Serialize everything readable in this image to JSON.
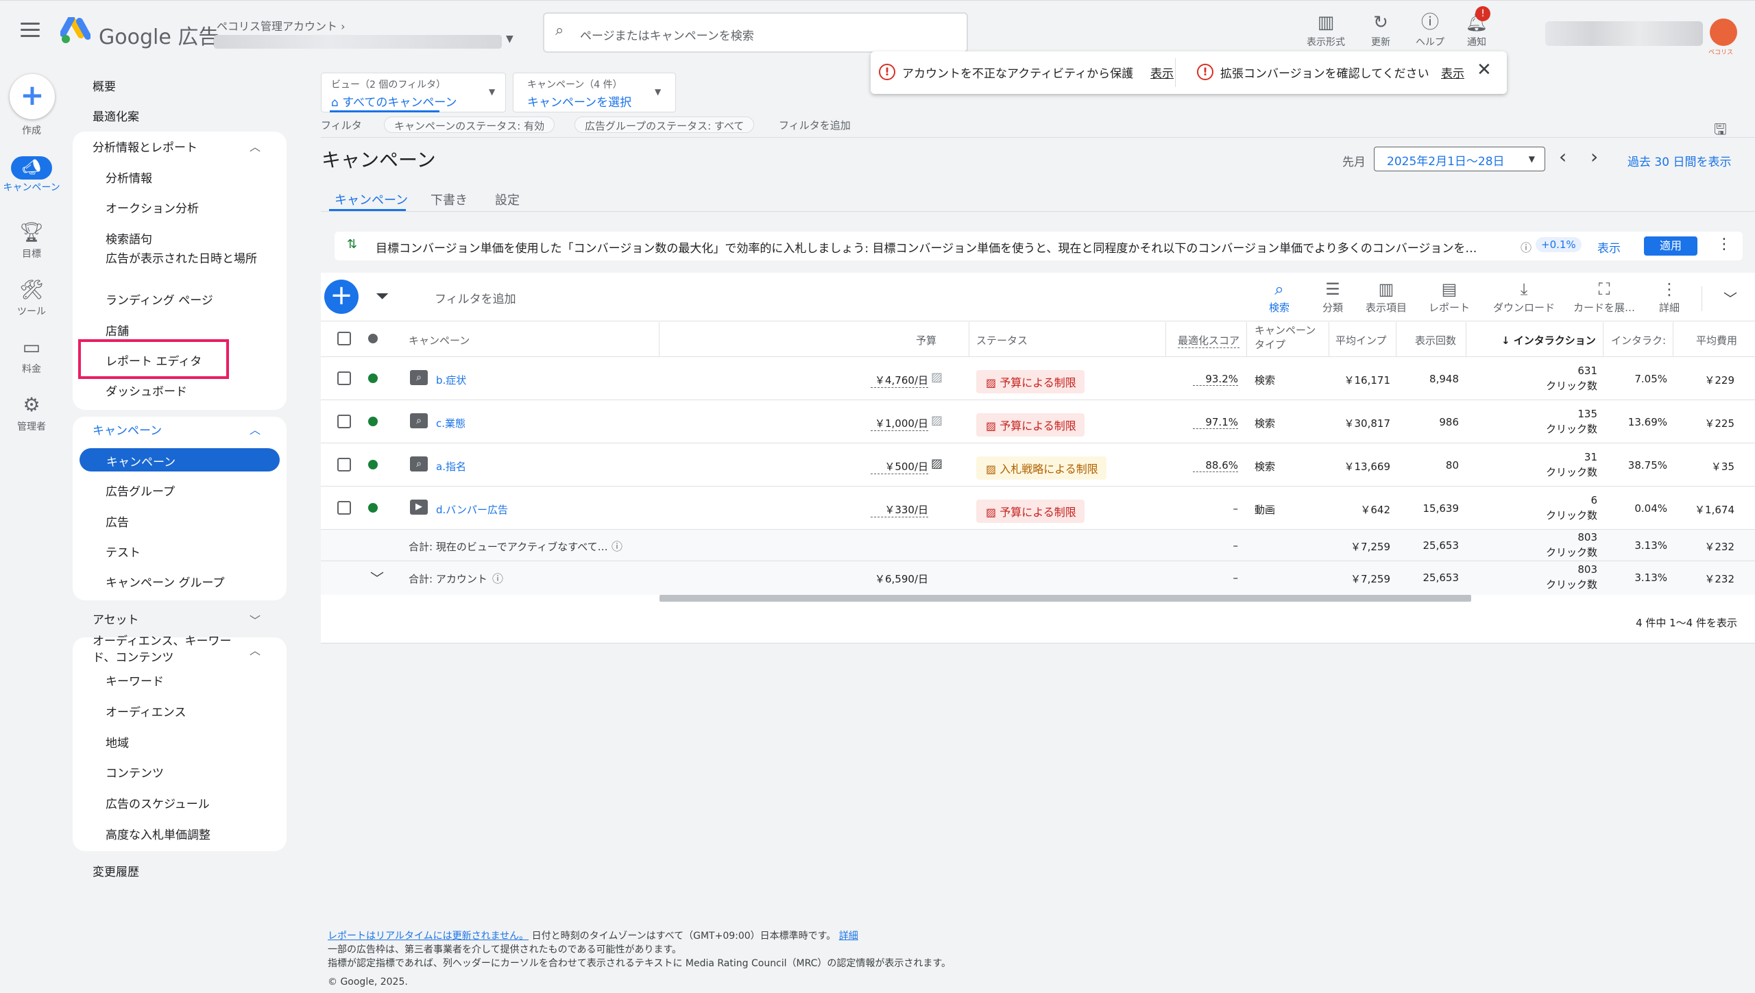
{
  "header": {
    "brand": "Google 広告",
    "account_label": "ペコリス管理アカウント",
    "search_placeholder": "ページまたはキャンペーンを検索",
    "tools": [
      "表示形式",
      "更新",
      "ヘルプ",
      "通知"
    ],
    "notif_badge": "!",
    "profile_label": "ペコリス"
  },
  "rail": {
    "create": "作成",
    "campaign": "キャンペーン",
    "goals": "目標",
    "tools": "ツール",
    "billing": "料金",
    "admin": "管理者"
  },
  "nav": {
    "overview": "概要",
    "recommendations": "最適化案",
    "insights_head": "分析情報とレポート",
    "insights_items": [
      "分析情報",
      "オークション分析",
      "検索語句",
      "広告が表示された日時と場所",
      "ランディング ページ",
      "店舗",
      "レポート エディタ",
      "ダッシュボード"
    ],
    "campaigns_head": "キャンペーン",
    "campaigns_items": [
      "キャンペーン",
      "広告グループ",
      "広告",
      "テスト",
      "キャンペーン グループ"
    ],
    "assets_head": "アセット",
    "audience_head": "オーディエンス、キーワード、コンテンツ",
    "audience_items": [
      "キーワード",
      "オーディエンス",
      "地域",
      "コンテンツ",
      "広告のスケジュール",
      "高度な入札単価調整"
    ],
    "change_history": "変更履歴"
  },
  "filters": {
    "view_label": "ビュー（2 個のフィルタ）",
    "view_value": "すべてのキャンペーン",
    "campaign_label": "キャンペーン（4 件）",
    "campaign_value": "キャンペーンを選択",
    "filter_label": "フィルタ",
    "chip1": "キャンペーンのステータス: 有効",
    "chip2": "広告グループのステータス: すべて",
    "add_filter": "フィルタを追加"
  },
  "alerts": {
    "a1": "アカウントを不正なアクティビティから保護",
    "a1_link": "表示",
    "a2": "拡張コンバージョンを確認してください",
    "a2_link": "表示"
  },
  "page": {
    "title": "キャンペーン",
    "date_prefix": "先月",
    "date_range": "2025年2月1日〜28日",
    "last30": "過去 30 日間を表示",
    "tabs": [
      "キャンペーン",
      "下書き",
      "設定"
    ]
  },
  "reco": {
    "text": "目標コンバージョン単価を使用した「コンバージョン数の最大化」で効率的に入札しましょう: 目標コンバージョン単価を使うと、現在と同程度かそれ以下のコンバージョン単価でより多くのコンバージョンを…",
    "uplift": "+0.1%",
    "view": "表示",
    "apply": "適用"
  },
  "toolbar": {
    "add_filter": "フィルタを追加",
    "items": [
      "検索",
      "分類",
      "表示項目",
      "レポート",
      "ダウンロード",
      "カードを展…",
      "詳細"
    ]
  },
  "table": {
    "headers": {
      "campaign": "キャンペーン",
      "budget": "予算",
      "status": "ステータス",
      "opt": "最適化スコア",
      "type": "キャンペーン タイプ",
      "avg_imp": "平均インプ",
      "impr": "表示回数",
      "interactions": "インタラクション",
      "int_rate": "インタラク:",
      "avg_cost": "平均費用"
    },
    "rows": [
      {
        "name": "b.症状",
        "budget": "￥4,760/日",
        "status": "予算による制限",
        "opt": "93.2%",
        "type": "検索",
        "avg_imp": "￥16,171",
        "impr": "8,948",
        "int": "631",
        "int_unit": "クリック数",
        "rate": "7.05%",
        "cost": "￥229"
      },
      {
        "name": "c.業態",
        "budget": "￥1,000/日",
        "status": "予算による制限",
        "opt": "97.1%",
        "type": "検索",
        "avg_imp": "￥30,817",
        "impr": "986",
        "int": "135",
        "int_unit": "クリック数",
        "rate": "13.69%",
        "cost": "￥225"
      },
      {
        "name": "a.指名",
        "budget": "￥500/日",
        "status": "入札戦略による制限",
        "opt": "88.6%",
        "type": "検索",
        "avg_imp": "￥13,669",
        "impr": "80",
        "int": "31",
        "int_unit": "クリック数",
        "rate": "38.75%",
        "cost": "￥35"
      },
      {
        "name": "d.バンパー広告",
        "budget": "￥330/日",
        "status": "予算による制限",
        "opt": "–",
        "type": "動画",
        "avg_imp": "￥642",
        "impr": "15,639",
        "int": "6",
        "int_unit": "クリック数",
        "rate": "0.04%",
        "cost": "￥1,674"
      }
    ],
    "total1": {
      "label": "合計: 現在のビューでアクティブなすべて…",
      "opt": "–",
      "avg_imp": "￥7,259",
      "impr": "25,653",
      "int": "803",
      "int_unit": "クリック数",
      "rate": "3.13%",
      "cost": "￥232"
    },
    "total2": {
      "label": "合計: アカウント",
      "budget": "￥6,590/日",
      "opt": "–",
      "avg_imp": "￥7,259",
      "impr": "25,653",
      "int": "803",
      "int_unit": "クリック数",
      "rate": "3.13%",
      "cost": "￥232"
    },
    "pagination": "4 件中 1〜4 件を表示"
  },
  "footer": {
    "l1_link": "レポートはリアルタイムには更新されません。",
    "l1_text": "日付と時刻のタイムゾーンはすべて（GMT+09:00）日本標準時です。",
    "l1_more": "詳細",
    "l2": "一部の広告枠は、第三者事業者を介して提供されたものである可能性があります。",
    "l3": "指標が認定指標であれば、列ヘッダーにカーソルを合わせて表示されるテキストに Media Rating Council（MRC）の認定情報が表示されます。",
    "l4": "© Google, 2025."
  },
  "colors": {
    "accent": "#1a73e8",
    "highlight": "#e91e63",
    "status_red": "#c5221f",
    "status_yellow": "#b06000",
    "active_dot": "#188038"
  }
}
